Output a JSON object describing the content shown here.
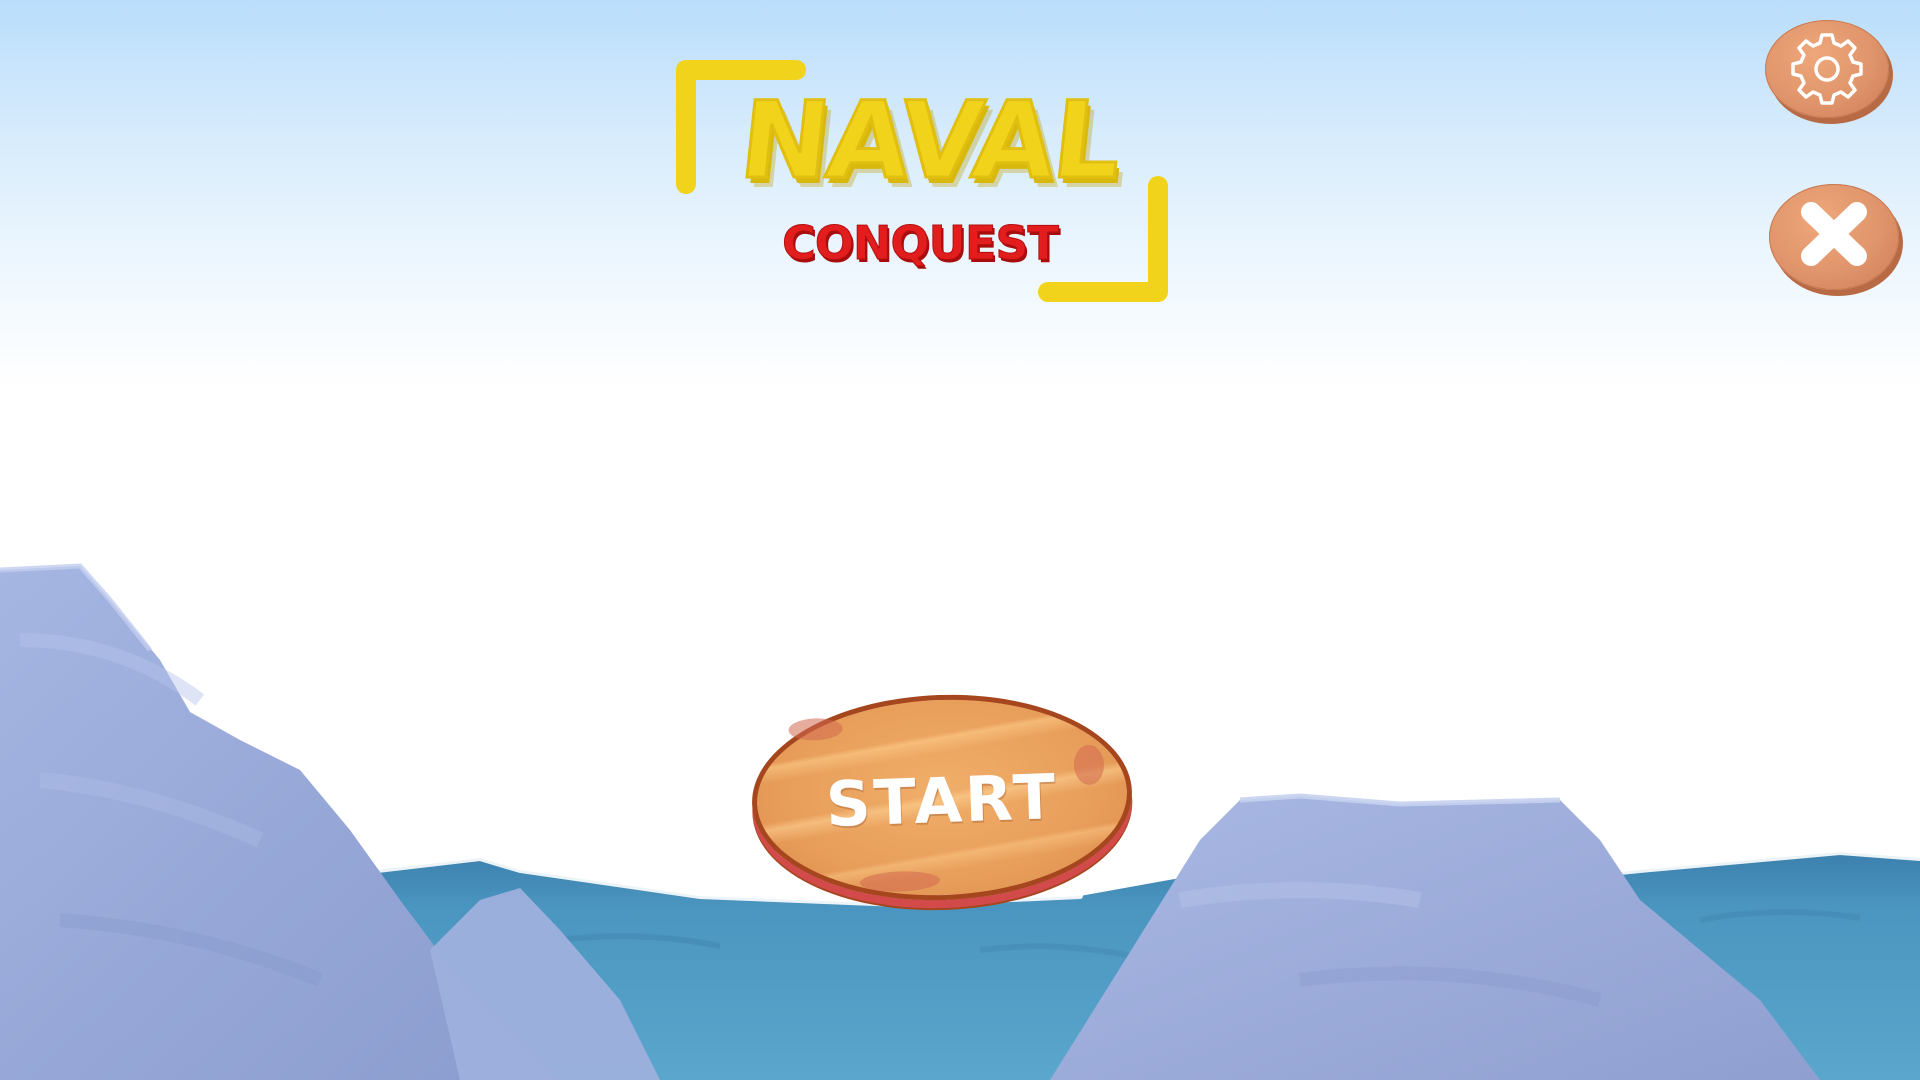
{
  "game": {
    "title": "NAVAL",
    "subtitle": "CONQUEST"
  },
  "buttons": {
    "start_label": "START",
    "settings_icon": "gear-icon",
    "close_icon": "close-icon"
  },
  "colors": {
    "sky_top": "#b9ddfb",
    "sea": "#4f9cc4",
    "iceberg": "#9fb0dc",
    "button_orange": "#e89e5b",
    "title_yellow": "#f2d31b",
    "subtitle_red": "#e21d1d"
  }
}
